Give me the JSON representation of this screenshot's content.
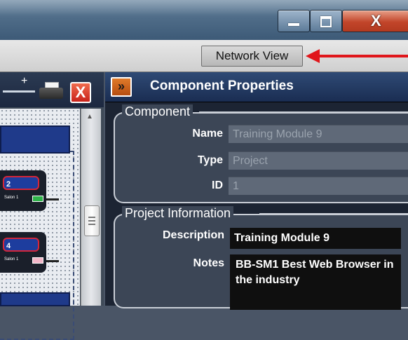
{
  "window": {
    "controls": {
      "minimize_icon": "minimize-icon",
      "maximize_icon": "maximize-icon",
      "close_label": "X"
    }
  },
  "toolbar": {
    "network_view_label": "Network View",
    "annotation_arrow_color": "#e0161b"
  },
  "left_panel": {
    "zoom_plus": "+",
    "delete_label": "X",
    "nodes": [
      {
        "id_label": "2",
        "port_label": "Salon 1",
        "led_color": "#2fb34a"
      },
      {
        "id_label": "4",
        "port_label": "Salon 1",
        "led_color": "#f3b6c8"
      }
    ]
  },
  "properties": {
    "expand_icon": "»",
    "title": "Component Properties",
    "component_group": {
      "legend": "Component",
      "fields": [
        {
          "label": "Name",
          "value": "Training Module 9"
        },
        {
          "label": "Type",
          "value": "Project"
        },
        {
          "label": "ID",
          "value": "1"
        }
      ]
    },
    "project_group": {
      "legend": "Project Information",
      "description_label": "Description",
      "description_value": "Training Module 9",
      "notes_label": "Notes",
      "notes_value": "BB-SM1 Best Web Browser in the industry"
    }
  },
  "colors": {
    "accent_orange": "#d0661e",
    "header_blue": "#1a2d52",
    "close_red": "#c9231b"
  }
}
